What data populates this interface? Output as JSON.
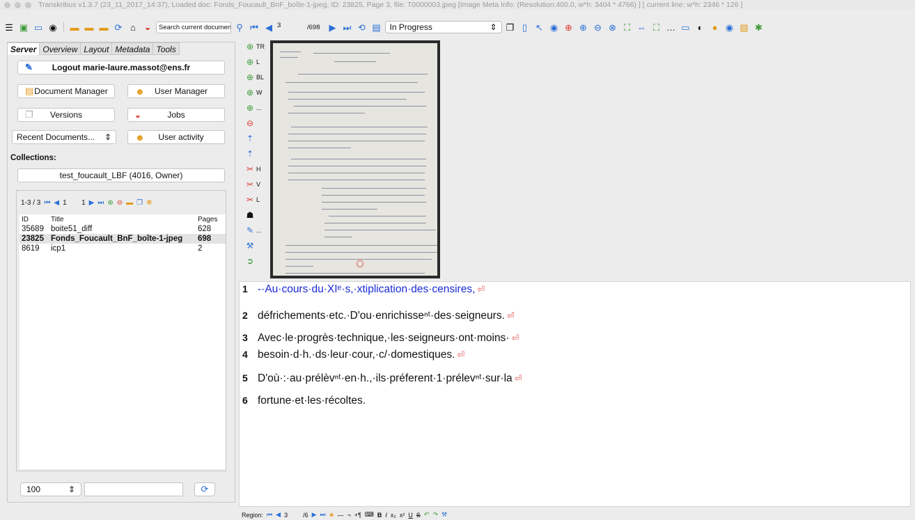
{
  "window": {
    "title": "Transkribus v1.3.7 (23_11_2017_14:37), Loaded doc: Fonds_Foucault_BnF_boîte-1-jpeg, ID: 23825, Page 3, file: T0000003.jpeg [Image Meta Info: (Resolution:400.0, w*h: 3404 * 4766) ] [ current line: w*h: 2346 * 126 ]"
  },
  "toolbar": {
    "search_placeholder": "Search current document...",
    "page_current": "3",
    "page_total": "/698",
    "status_value": "In Progress"
  },
  "left_panel": {
    "tabs": [
      "Server",
      "Overview",
      "Layout",
      "Metadata",
      "Tools"
    ],
    "logout_label": "Logout marie-laure.massot@ens.fr",
    "document_manager_label": "Document Manager",
    "user_manager_label": "User Manager",
    "versions_label": "Versions",
    "jobs_label": "Jobs",
    "recent_documents_label": "Recent Documents...",
    "user_activity_label": "User activity",
    "collections_label": "Collections:",
    "collection_value": "test_foucault_LBF (4016, Owner)",
    "docs_nav": {
      "range": "1-3 / 3",
      "page": "1",
      "page_total": "1"
    },
    "table": {
      "headers": [
        "ID",
        "Title",
        "Pages"
      ],
      "rows": [
        {
          "id": "35689",
          "title": "boite51_diff",
          "pages": "628",
          "selected": false
        },
        {
          "id": "23825",
          "title": "Fonds_Foucault_BnF_boîte-1-jpeg",
          "pages": "698",
          "selected": true
        },
        {
          "id": "8619",
          "title": "icp1",
          "pages": "2",
          "selected": false
        }
      ]
    },
    "zoom_value": "100"
  },
  "vertical_tools": [
    {
      "label": "TR",
      "icon": "plus-circle-icon"
    },
    {
      "label": "L",
      "icon": "plus-circle-icon"
    },
    {
      "label": "BL",
      "icon": "plus-circle-icon"
    },
    {
      "label": "W",
      "icon": "plus-circle-icon"
    },
    {
      "label": "...",
      "icon": "plus-circle-icon"
    },
    {
      "label": "",
      "icon": "minus-circle-icon"
    },
    {
      "label": "",
      "icon": "merge-icon"
    },
    {
      "label": "",
      "icon": "merge-icon"
    },
    {
      "label": "H",
      "icon": "scissors-icon"
    },
    {
      "label": "V",
      "icon": "scissors-icon"
    },
    {
      "label": "L",
      "icon": "scissors-icon"
    },
    {
      "label": "",
      "icon": "person-icon"
    },
    {
      "label": "...",
      "icon": "edit-icon"
    },
    {
      "label": "",
      "icon": "wrench-icon"
    },
    {
      "label": "",
      "icon": "arrow-icon"
    }
  ],
  "editor": {
    "lines": [
      {
        "num": "1",
        "text": "-·Au·cours·du·XIᵉ·s,·xtiplication·des·censires,",
        "active": true
      },
      {
        "num": "2",
        "text": "défrichements·etc.·D'ou·enrichisseⁿᵗ·des·seigneurs.",
        "active": false
      },
      {
        "num": "3",
        "text": "Avec·le·progrès·technique,·les·seigneurs·ont·moins·",
        "active": false
      },
      {
        "num": "4",
        "text": "besoin·d·h.·ds·leur·cour,·c/·domestiques.",
        "active": false
      },
      {
        "num": "5",
        "text": "D'où·:·au·prélèvⁿᵗ·en·h.,·ils·préferent·1·prélevⁿᵗ·sur·la",
        "active": false
      },
      {
        "num": "6",
        "text": "fortune·et·les·récoltes.",
        "active": false
      }
    ]
  },
  "bottom_bar": {
    "region_label": "Region:",
    "page_current": "3",
    "page_total": "/6"
  }
}
